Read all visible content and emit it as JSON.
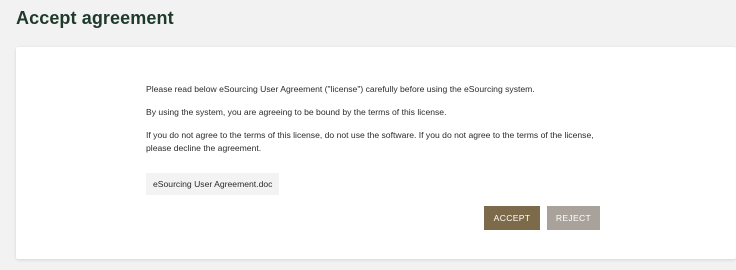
{
  "page": {
    "title": "Accept agreement"
  },
  "agreement": {
    "paragraphs": [
      "Please read below eSourcing User Agreement (\"license\") carefully before using the eSourcing system.",
      "By using the system, you are agreeing to be bound by the terms of this license.",
      "If you do not agree to the terms of this license, do not use the software. If you do not agree to the terms of the license, please decline the agreement."
    ],
    "file_name": "eSourcing User Agreement.doc"
  },
  "actions": {
    "accept_label": "ACCEPT",
    "reject_label": "REJECT"
  },
  "colors": {
    "accept": "#7d6a4a",
    "reject": "#a8a29a",
    "title": "#1f3a2a"
  }
}
